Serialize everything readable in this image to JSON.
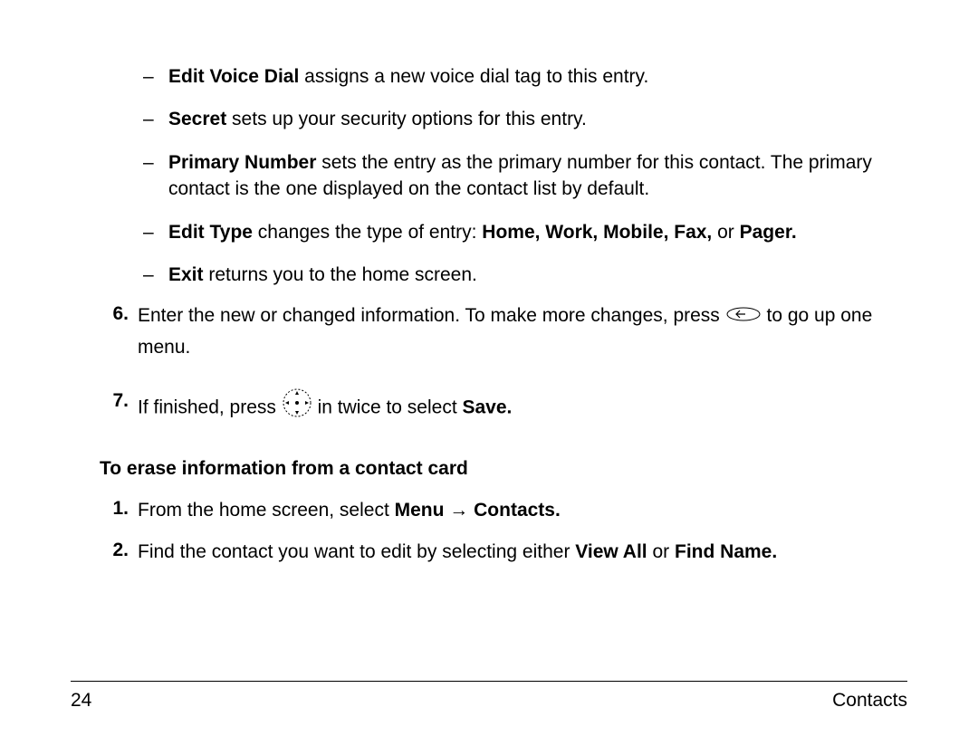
{
  "dashItems": [
    {
      "bold": "Edit Voice Dial",
      "rest": " assigns a new voice dial tag to this entry."
    },
    {
      "bold": "Secret",
      "rest": " sets up your security options for this entry."
    },
    {
      "bold": "Primary Number",
      "rest": " sets the entry as the primary number for this contact. The primary contact is the one displayed on the contact list by default."
    },
    {
      "bold": "Edit Type",
      "rest_pre": " changes the type of entry: ",
      "bold2": "Home, Work, Mobile, Fax,",
      "rest_post": " or ",
      "bold3": "Pager."
    },
    {
      "bold": "Exit",
      "rest": " returns you to the home screen."
    }
  ],
  "step6": {
    "num": "6.",
    "pre": "Enter the new or changed information. To make more changes, press ",
    "post": " to go up one menu."
  },
  "step7": {
    "num": "7.",
    "pre": "If finished, press ",
    "mid": " in twice to select ",
    "bold": "Save."
  },
  "heading": "To erase information from a contact card",
  "erase": {
    "s1": {
      "num": "1.",
      "pre": "From the home screen, select ",
      "bold1": "Menu",
      "arrow": " → ",
      "bold2": "Contacts."
    },
    "s2": {
      "num": "2.",
      "pre": "Find the contact you want to edit by selecting either ",
      "bold1": "View All",
      "mid": " or ",
      "bold2": "Find Name."
    }
  },
  "footer": {
    "page": "24",
    "section": "Contacts"
  }
}
